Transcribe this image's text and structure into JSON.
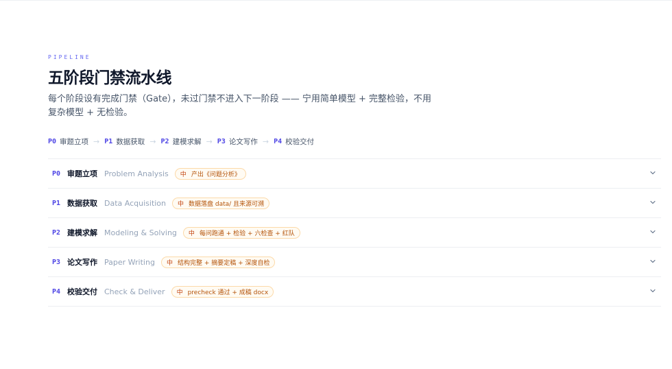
{
  "header": {
    "eyebrow": "PIPELINE",
    "title": "五阶段门禁流水线",
    "description": "每个阶段设有完成门禁（Gate），未过门禁不进入下一阶段 —— 宁用简单模型 + 完整检验，不用复杂模型 + 无检验。"
  },
  "flow": [
    {
      "code": "P0",
      "label": "审题立项"
    },
    {
      "code": "P1",
      "label": "数据获取"
    },
    {
      "code": "P2",
      "label": "建模求解"
    },
    {
      "code": "P3",
      "label": "论文写作"
    },
    {
      "code": "P4",
      "label": "校验交付"
    }
  ],
  "flow_arrow": "→",
  "stages": [
    {
      "code": "P0",
      "title": "审题立项",
      "english": "Problem Analysis",
      "gate_icon": "中",
      "gate": "产出《问题分析》"
    },
    {
      "code": "P1",
      "title": "数据获取",
      "english": "Data Acquisition",
      "gate_icon": "中",
      "gate": "数据落盘 data/ 且来源可溯"
    },
    {
      "code": "P2",
      "title": "建模求解",
      "english": "Modeling & Solving",
      "gate_icon": "中",
      "gate": "每问跑通 + 检验 + 六检查 + 红队"
    },
    {
      "code": "P3",
      "title": "论文写作",
      "english": "Paper Writing",
      "gate_icon": "中",
      "gate": "结构完整 + 摘要定稿 + 深度自检"
    },
    {
      "code": "P4",
      "title": "校验交付",
      "english": "Check & Deliver",
      "gate_icon": "中",
      "gate": "precheck 通过 + 成稿 docx"
    }
  ],
  "icons": {
    "expand": "chevron-down-icon"
  },
  "colors": {
    "accent": "#4f46e5",
    "gate_border": "#fcd9a8",
    "gate_text": "#b45309"
  }
}
